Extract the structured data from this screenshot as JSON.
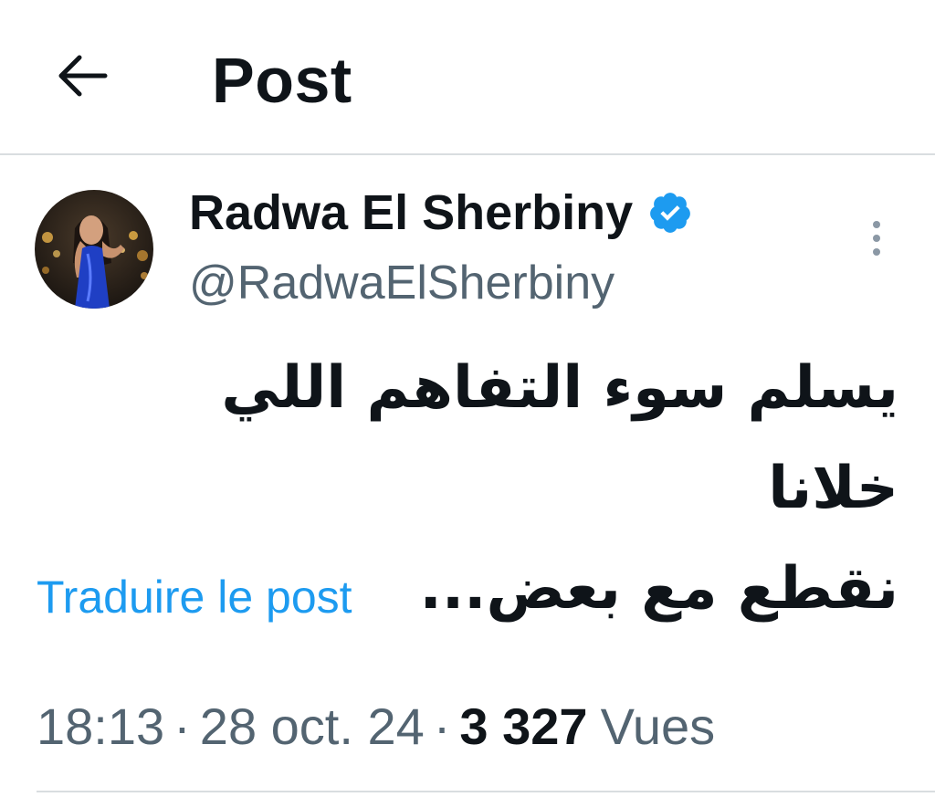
{
  "header": {
    "title": "Post",
    "back_icon": "arrow-left-icon"
  },
  "author": {
    "name": "Radwa El Sherbiny",
    "handle": "@RadwaElSherbiny",
    "verified": true,
    "verified_color": "#1d9bf0",
    "avatar_icon": "avatar-photo"
  },
  "post": {
    "text_line_1": "يسلم سوء التفاهم اللي خلانا",
    "text_line_2": "نقطع مع بعض...",
    "translate_label": "Traduire le post"
  },
  "meta": {
    "time": "18:13",
    "separator": "·",
    "date": "28 oct. 24",
    "views_count": "3 327",
    "views_label": "Vues"
  },
  "colors": {
    "link": "#1d9bf0",
    "secondary_text": "#536471",
    "primary_text": "#0f1419",
    "divider": "#d9dde0"
  }
}
